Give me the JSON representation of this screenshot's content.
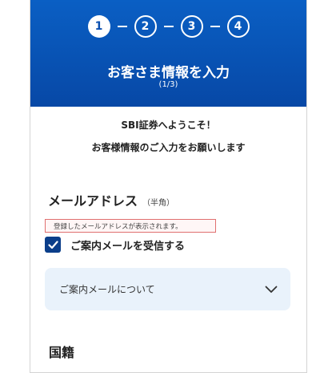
{
  "stepper": {
    "steps": [
      "1",
      "2",
      "3",
      "4"
    ],
    "active_step": 1
  },
  "header": {
    "title": "お客さま情報を入力",
    "subtitle": "(1/3)"
  },
  "welcome": {
    "line1": "SBI証券へようこそ！",
    "line2": "お客様情報のご入力をお願いします"
  },
  "email_section": {
    "title": "メールアドレス",
    "note": "（半角）",
    "display_text": "登録したメールアドレスが表示されます。",
    "checkbox_label": "ご案内メールを受信する",
    "checkbox_checked": true
  },
  "accordion": {
    "label": "ご案内メールについて"
  },
  "nationality": {
    "title": "国籍"
  },
  "colors": {
    "header_blue": "#0a5fc4",
    "checkbox_navy": "#0b3e8a",
    "accordion_bg": "#e9f2fb",
    "highlight_border": "#e07070"
  },
  "icons": {
    "checkmark": "check-icon",
    "chevron": "chevron-down-icon"
  }
}
